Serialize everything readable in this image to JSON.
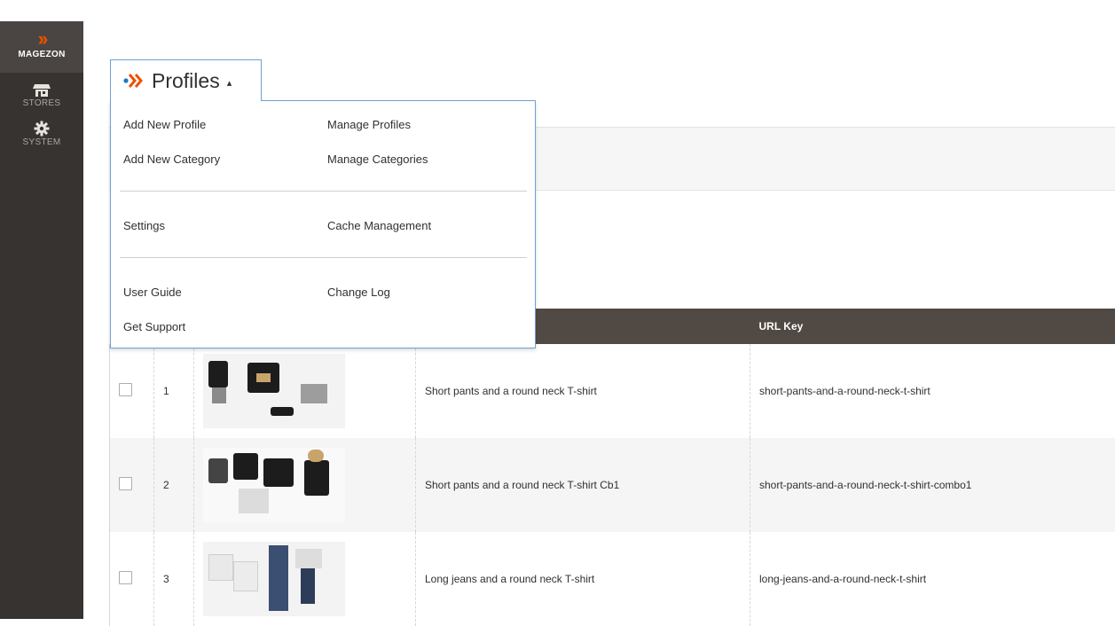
{
  "sidebar": {
    "brand": {
      "label": "MAGEZON",
      "icon": "magezon-chevrons-icon"
    },
    "items": [
      {
        "label": "STORES",
        "icon": "store-icon"
      },
      {
        "label": "SYSTEM",
        "icon": "gear-icon"
      }
    ]
  },
  "profiles_menu": {
    "title": "Profiles",
    "caret": "▴",
    "columns_left": [
      "Add New Profile",
      "Add New Category",
      "Settings",
      "User Guide",
      "Get Support"
    ],
    "columns_right": [
      "Manage Profiles",
      "Manage Categories",
      "Cache Management",
      "Change Log"
    ]
  },
  "grid": {
    "headers": [
      "",
      "",
      "",
      "",
      "URL Key"
    ],
    "rows": [
      {
        "id": "1",
        "name": "Short pants and a round neck T-shirt",
        "url_key": "short-pants-and-a-round-neck-t-shirt"
      },
      {
        "id": "2",
        "name": "Short pants and a round neck T-shirt Cb1",
        "url_key": "short-pants-and-a-round-neck-t-shirt-combo1"
      },
      {
        "id": "3",
        "name": "Long jeans and a round neck T-shirt",
        "url_key": "long-jeans-and-a-round-neck-t-shirt"
      }
    ]
  },
  "colors": {
    "accent": "#eb5202",
    "blue": "#1979c3",
    "sidebar": "#373330",
    "header": "#514943"
  }
}
